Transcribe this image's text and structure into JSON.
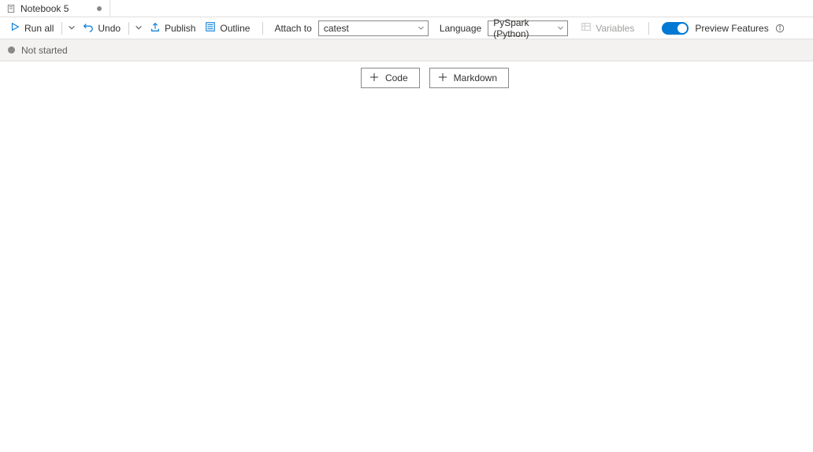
{
  "tab": {
    "title": "Notebook 5"
  },
  "toolbar": {
    "run_all": "Run all",
    "undo": "Undo",
    "publish": "Publish",
    "outline": "Outline",
    "attach_label": "Attach to",
    "attach_value": "catest",
    "language_label": "Language",
    "language_value": "PySpark (Python)",
    "variables": "Variables",
    "preview_features": "Preview Features"
  },
  "status": {
    "text": "Not started"
  },
  "actions": {
    "code": "Code",
    "markdown": "Markdown"
  }
}
